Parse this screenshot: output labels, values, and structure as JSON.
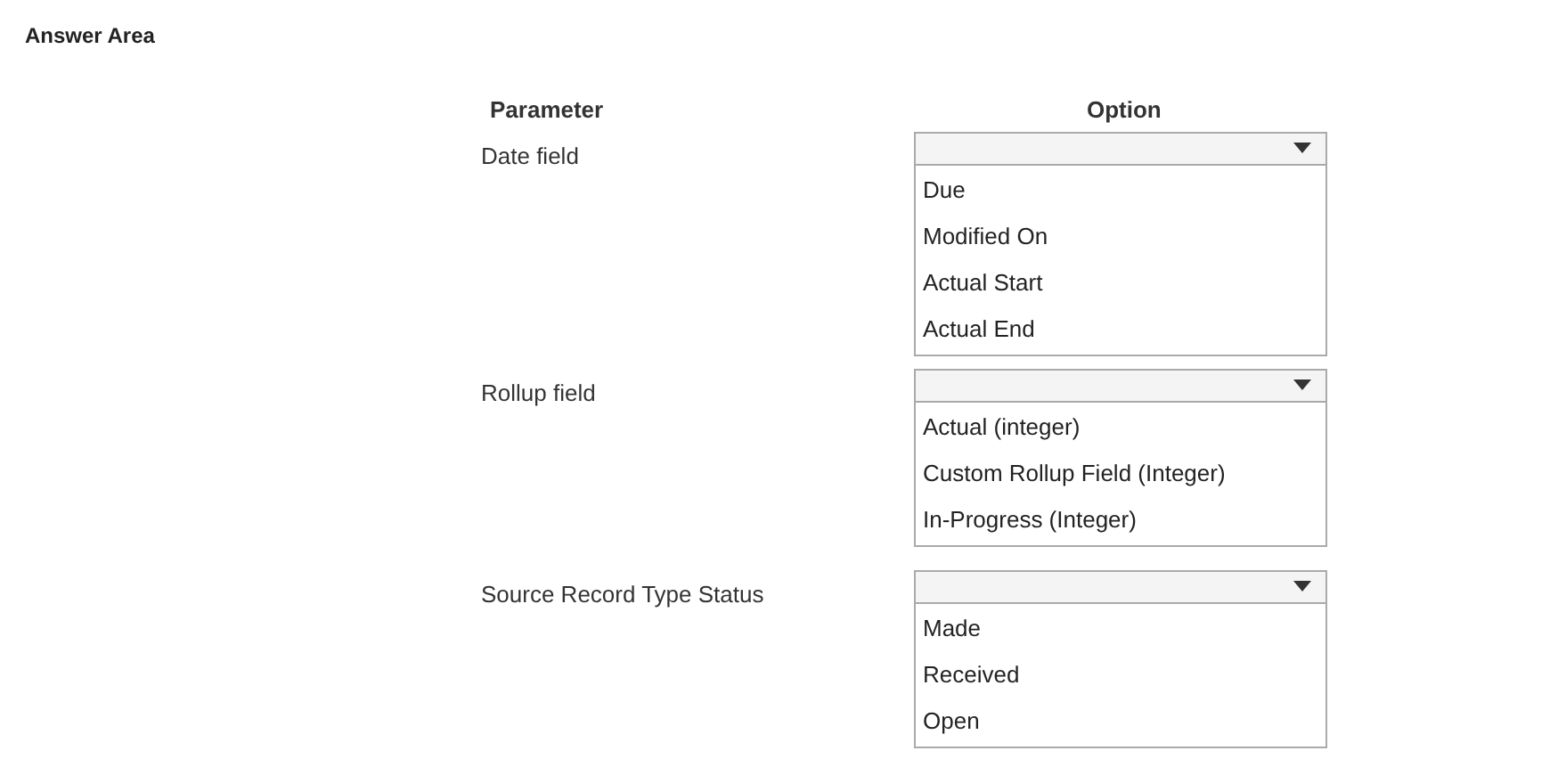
{
  "title": "Answer Area",
  "columns": [
    "Parameter",
    "Option"
  ],
  "rows": [
    {
      "parameter": "Date field",
      "options": [
        "Due",
        "Modified On",
        "Actual Start",
        "Actual End"
      ]
    },
    {
      "parameter": "Rollup field",
      "options": [
        "Actual (integer)",
        "Custom Rollup Field (Integer)",
        "In-Progress (Integer)"
      ]
    },
    {
      "parameter": "Source Record Type Status",
      "options": [
        "Made",
        "Received",
        "Open"
      ]
    }
  ]
}
